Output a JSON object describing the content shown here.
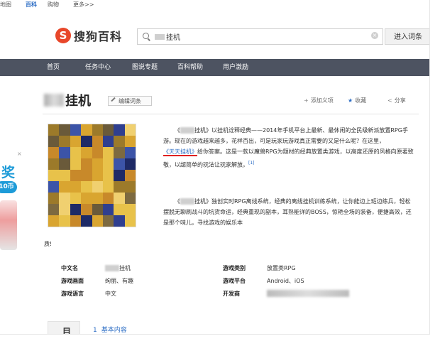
{
  "toplinks": [
    "地图",
    "百科",
    "购物",
    "更多>>"
  ],
  "brand": {
    "mark": "S",
    "name": "搜狗百科",
    "color": "#e8472a"
  },
  "search": {
    "value": "挂机",
    "enter_label": "进入词条"
  },
  "nav": [
    "首页",
    "任务中心",
    "图说专题",
    "百科帮助",
    "用户激励"
  ],
  "ad": {
    "text1": "奖",
    "text2": "10币"
  },
  "entry": {
    "title": "挂机",
    "edit_label": "编辑词条",
    "actions": {
      "add_meaning": "添加义项",
      "favorite": "收藏",
      "share": "分享"
    }
  },
  "intro": {
    "p1_a": "《",
    "p1_b": "挂机》以挂机诠释经典——2014年手机平台上最新、最休闲的全民级新派放置RPG手游。现在的游戏越来越多，花样百出，可是玩家玩游戏真正需要的又是什么呢？在这里，",
    "p1_link": "《天天挂机》",
    "p1_c": "给你答案。这是一款以魔兽RPG为题材的经典放置类游戏，以高度还原的风格向原著致敬，以超简单的玩法让玩家解放。",
    "p1_sup": "[1]",
    "p2_a": "《",
    "p2_b": "挂机》独创实时RPG离线系统，经典的离线挂机训练系统，让你能边上班边练兵，轻松摆脱无聊刷战斗的坑货命运，经典重现的副本，耳熟能详的BOSS，惊艳全场的装备，便捷高效，还是那个味儿，寻找游戏的娱乐本",
    "p2_cont": "质!"
  },
  "infobox": {
    "cn_name_label": "中文名",
    "cn_name_value": "挂机",
    "genre_label": "游戏类别",
    "genre_value": "放置类RPG",
    "style_label": "游戏画面",
    "style_value": "绚丽、有趣",
    "platform_label": "游戏平台",
    "platform_value": "Android、iOS",
    "lang_label": "游戏语言",
    "lang_value": "中文",
    "dev_label": "开发商"
  },
  "toc": {
    "box_label": "目",
    "item_num": "1",
    "item_label": "基本内容"
  }
}
